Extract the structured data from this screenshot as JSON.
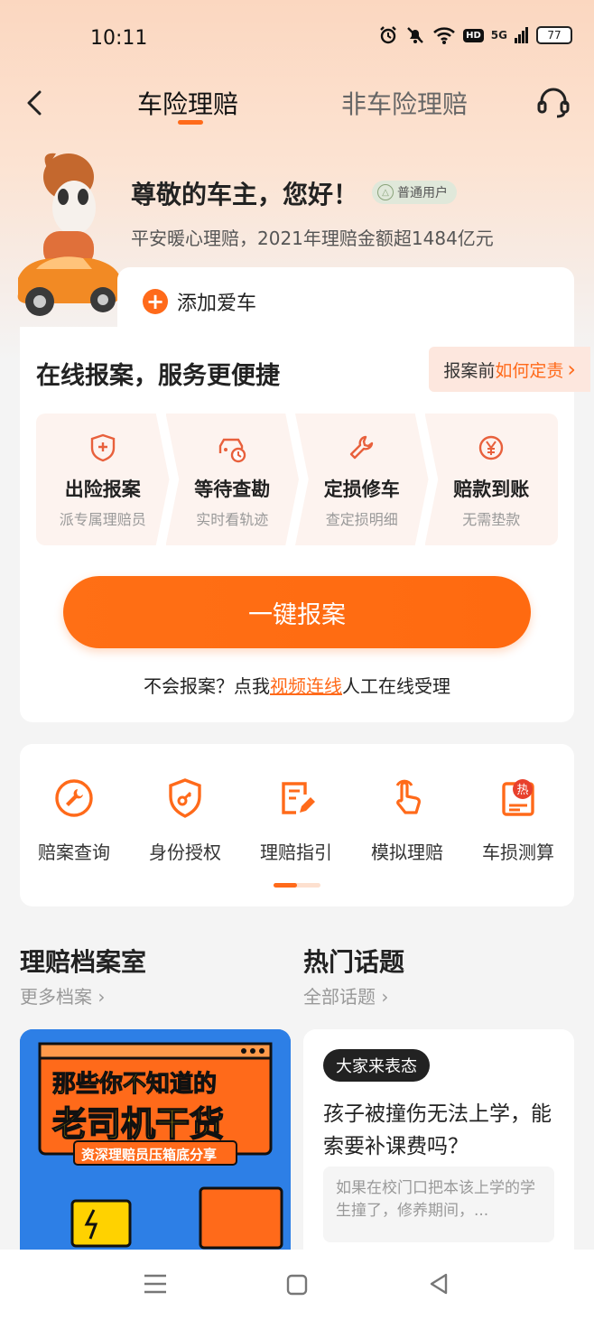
{
  "status_bar": {
    "time": "10:11",
    "battery": "77",
    "network": "5G",
    "hd": "HD"
  },
  "navbar": {
    "tab_active": "车险理赔",
    "tab_other": "非车险理赔"
  },
  "hero": {
    "greeting": "尊敬的车主，您好！",
    "badge": "普通用户",
    "subtitle": "平安暖心理赔，2021年理赔金额超1484亿元",
    "add_car": "添加爱车"
  },
  "report_card": {
    "title": "在线报案，服务更便捷",
    "how_prefix": "报案前",
    "how_highlight": "如何定责",
    "how_arrow": "›",
    "steps": [
      {
        "title": "出险报案",
        "sub": "派专属理赔员",
        "icon": "shield-plus-icon"
      },
      {
        "title": "等待查勘",
        "sub": "实时看轨迹",
        "icon": "car-clock-icon"
      },
      {
        "title": "定损修车",
        "sub": "查定损明细",
        "icon": "wrench-icon"
      },
      {
        "title": "赔款到账",
        "sub": "无需垫款",
        "icon": "yen-coin-icon"
      }
    ],
    "cta": "一键报案",
    "help_prefix": "不会报案？点我",
    "help_link": "视频连线",
    "help_suffix": "人工在线受理"
  },
  "tools": [
    {
      "label": "赔案查询",
      "icon": "wrench-circle-icon"
    },
    {
      "label": "身份授权",
      "icon": "shield-key-icon"
    },
    {
      "label": "理赔指引",
      "icon": "document-edit-icon"
    },
    {
      "label": "模拟理赔",
      "icon": "hand-tap-icon"
    },
    {
      "label": "车损测算",
      "icon": "hot-document-icon"
    }
  ],
  "hot_badge": "热",
  "archive": {
    "title": "理赔档案室",
    "more": "更多档案 ›"
  },
  "topics": {
    "title": "热门话题",
    "more": "全部话题 ›"
  },
  "poster": {
    "line1": "那些你不知道的",
    "line2": "老司机干货",
    "line3": "资深理赔员压箱底分享"
  },
  "topic_card": {
    "tag": "大家来表态",
    "question": "孩子被撞伤无法上学，能索要补课费吗？",
    "excerpt": "如果在校门口把本该上学的学生撞了，修养期间，..."
  },
  "colors": {
    "accent": "#ff6a1a",
    "card_tint": "#fdf3ef",
    "header_bg": "#fbd7c0"
  }
}
